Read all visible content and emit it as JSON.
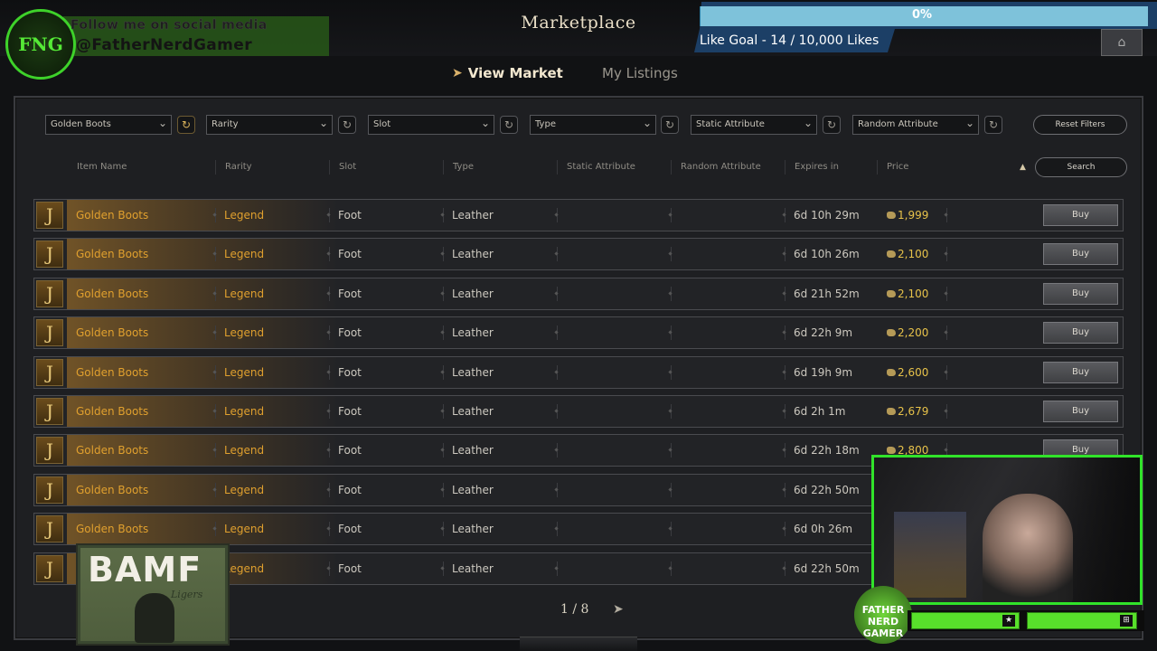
{
  "header": {
    "title": "Marketplace",
    "tabs": [
      {
        "label": "View Market",
        "active": true
      },
      {
        "label": "My Listings",
        "active": false
      }
    ]
  },
  "filters": {
    "item": "Golden Boots",
    "rarity": "Rarity",
    "slot": "Slot",
    "type": "Type",
    "static_attribute": "Static Attribute",
    "random_attribute": "Random Attribute",
    "reset_label": "Reset Filters",
    "search_label": "Search"
  },
  "columns": [
    "Item Name",
    "Rarity",
    "Slot",
    "Type",
    "Static Attribute",
    "Random Attribute",
    "Expires in",
    "Price"
  ],
  "rows": [
    {
      "name": "Golden Boots",
      "rarity": "Legend",
      "slot": "Foot",
      "type": "Leather",
      "expires": "6d 10h 29m",
      "price": "1,999",
      "buy": "Buy"
    },
    {
      "name": "Golden Boots",
      "rarity": "Legend",
      "slot": "Foot",
      "type": "Leather",
      "expires": "6d 10h 26m",
      "price": "2,100",
      "buy": "Buy"
    },
    {
      "name": "Golden Boots",
      "rarity": "Legend",
      "slot": "Foot",
      "type": "Leather",
      "expires": "6d 21h 52m",
      "price": "2,100",
      "buy": "Buy"
    },
    {
      "name": "Golden Boots",
      "rarity": "Legend",
      "slot": "Foot",
      "type": "Leather",
      "expires": "6d 22h 9m",
      "price": "2,200",
      "buy": "Buy"
    },
    {
      "name": "Golden Boots",
      "rarity": "Legend",
      "slot": "Foot",
      "type": "Leather",
      "expires": "6d 19h 9m",
      "price": "2,600",
      "buy": "Buy"
    },
    {
      "name": "Golden Boots",
      "rarity": "Legend",
      "slot": "Foot",
      "type": "Leather",
      "expires": "6d 2h 1m",
      "price": "2,679",
      "buy": "Buy"
    },
    {
      "name": "Golden Boots",
      "rarity": "Legend",
      "slot": "Foot",
      "type": "Leather",
      "expires": "6d 22h 18m",
      "price": "2,800",
      "buy": "Buy"
    },
    {
      "name": "Golden Boots",
      "rarity": "Legend",
      "slot": "Foot",
      "type": "Leather",
      "expires": "6d 22h 50m",
      "price": "",
      "buy": ""
    },
    {
      "name": "Golden Boots",
      "rarity": "Legend",
      "slot": "Foot",
      "type": "Leather",
      "expires": "6d 0h 26m",
      "price": "",
      "buy": ""
    },
    {
      "name": "Golden Boots",
      "rarity": "Legend",
      "slot": "Foot",
      "type": "Leather",
      "expires": "6d 22h 50m",
      "price": "",
      "buy": ""
    }
  ],
  "pagination": {
    "text": "1 / 8"
  },
  "overlay": {
    "follow_text": "Follow me on social media",
    "handle": "@FatherNerdGamer",
    "logo_text": "FNG",
    "goal_percent": "0%",
    "goal_fraction": 0.0014,
    "goal_label": "Like Goal - 14 / 10,000 Likes",
    "badge_title": "BAMF",
    "badge_tag": "Ligers",
    "badge2_text": "FATHER NERD GAMER"
  },
  "colors": {
    "accent_gold": "#e0a02e",
    "price_gold": "#e7c24a",
    "overlay_green": "#31e32a",
    "goal_blue": "#1c3f66"
  }
}
